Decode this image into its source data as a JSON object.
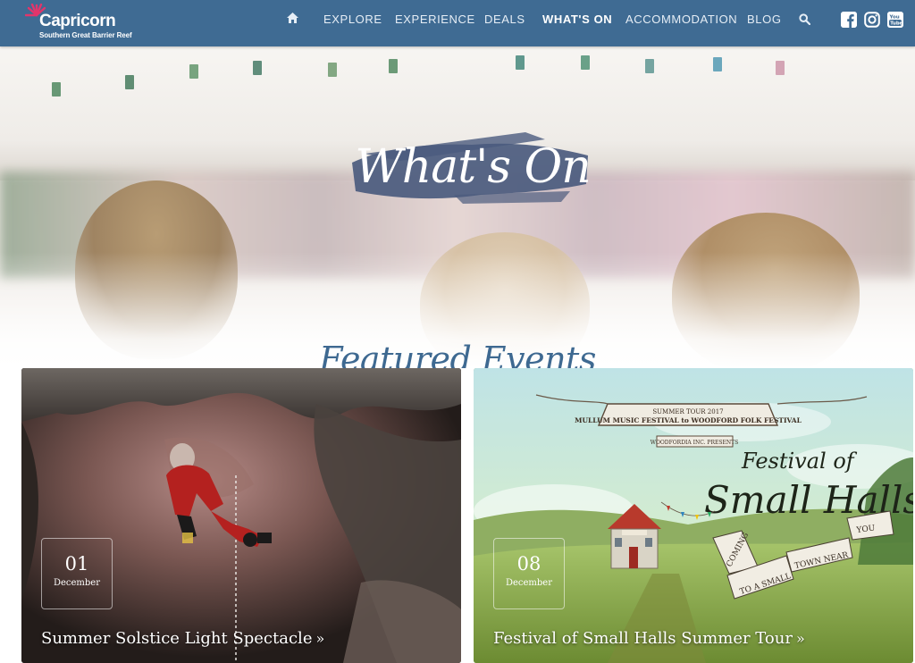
{
  "brand": {
    "name": "Capricorn",
    "tagline": "Southern Great Barrier Reef"
  },
  "nav": {
    "home_icon": "home-icon",
    "items": [
      {
        "label": "EXPLORE"
      },
      {
        "label": "EXPERIENCE"
      },
      {
        "label": "DEALS"
      },
      {
        "label": "WHAT'S ON",
        "active": true
      },
      {
        "label": "ACCOMMODATION"
      },
      {
        "label": "BLOG"
      }
    ],
    "search_icon": "search-icon",
    "social": [
      "facebook-icon",
      "instagram-icon",
      "youtube-icon"
    ]
  },
  "hero": {
    "title": "What's On"
  },
  "section": {
    "title": "Featured Events"
  },
  "events": [
    {
      "day": "01",
      "month": "December",
      "title": "Summer Solstice Light Spectacle"
    },
    {
      "day": "08",
      "month": "December",
      "title": "Festival of Small Halls Summer Tour",
      "poster": {
        "banner_small": "SUMMER TOUR 2017",
        "banner_main": "MULLUM MUSIC FESTIVAL to WOODFORD FOLK FESTIVAL",
        "presenter": "WOODFORDIA INC. PRESENTS",
        "headline_1": "Festival of",
        "headline_2": "Small Halls",
        "ribbon": [
          "COMING",
          "TO A SMALL",
          "TOWN NEAR",
          "YOU"
        ]
      }
    }
  ],
  "colors": {
    "nav_bg": "#3f6b93",
    "accent": "#3e6991",
    "logo_star": "#e2356b"
  }
}
